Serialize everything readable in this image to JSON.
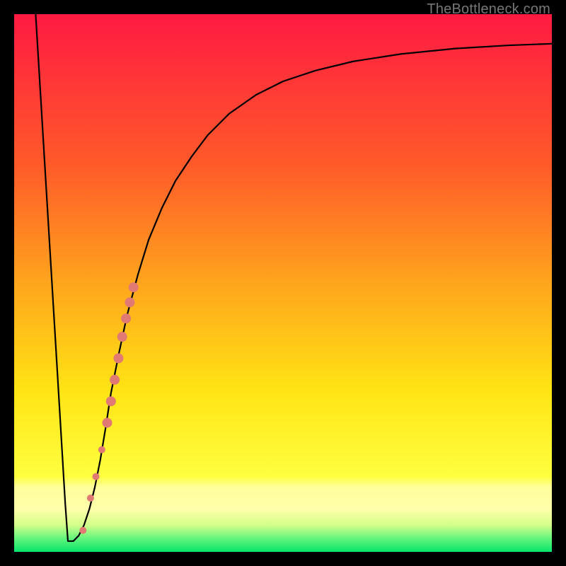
{
  "watermark": "TheBottleneck.com",
  "chart_data": {
    "type": "line",
    "title": "",
    "xlabel": "",
    "ylabel": "",
    "xlim": [
      0,
      100
    ],
    "ylim": [
      0,
      100
    ],
    "grid": false,
    "legend": false,
    "background_gradient": {
      "top": "#ff1a42",
      "mid1": "#ff8a1f",
      "mid2": "#ffe414",
      "band": "#ffff9d",
      "bottom": "#07e66b"
    },
    "series": [
      {
        "name": "curve",
        "color": "#000000",
        "x": [
          4.0,
          6.0,
          8.0,
          9.5,
          10.0,
          11.0,
          12.0,
          13.0,
          14.0,
          15.0,
          16.0,
          17.0,
          18.0,
          19.5,
          21.0,
          23.0,
          25.0,
          27.5,
          30.0,
          33.0,
          36.0,
          40.0,
          45.0,
          50.0,
          56.0,
          63.0,
          72.0,
          82.0,
          92.0,
          100.0
        ],
        "y": [
          100.0,
          67.0,
          34.0,
          9.0,
          2.0,
          2.0,
          3.0,
          5.0,
          8.0,
          12.0,
          17.0,
          23.0,
          29.5,
          37.0,
          44.0,
          51.5,
          58.0,
          64.0,
          69.0,
          73.5,
          77.5,
          81.5,
          85.0,
          87.5,
          89.5,
          91.2,
          92.6,
          93.6,
          94.2,
          94.5
        ]
      }
    ],
    "markers": [
      {
        "name": "red-dots",
        "color": "#e07a72",
        "points": [
          {
            "x": 12.8,
            "y": 4.0,
            "r": 5
          },
          {
            "x": 14.2,
            "y": 10.0,
            "r": 5
          },
          {
            "x": 15.2,
            "y": 14.0,
            "r": 5
          },
          {
            "x": 16.3,
            "y": 19.0,
            "r": 5
          },
          {
            "x": 17.3,
            "y": 24.0,
            "r": 7
          },
          {
            "x": 18.0,
            "y": 28.0,
            "r": 7
          },
          {
            "x": 18.7,
            "y": 32.0,
            "r": 7
          },
          {
            "x": 19.4,
            "y": 36.0,
            "r": 7
          },
          {
            "x": 20.1,
            "y": 40.0,
            "r": 7
          },
          {
            "x": 20.8,
            "y": 43.4,
            "r": 7
          },
          {
            "x": 21.5,
            "y": 46.4,
            "r": 7
          },
          {
            "x": 22.2,
            "y": 49.2,
            "r": 7
          }
        ]
      }
    ]
  }
}
